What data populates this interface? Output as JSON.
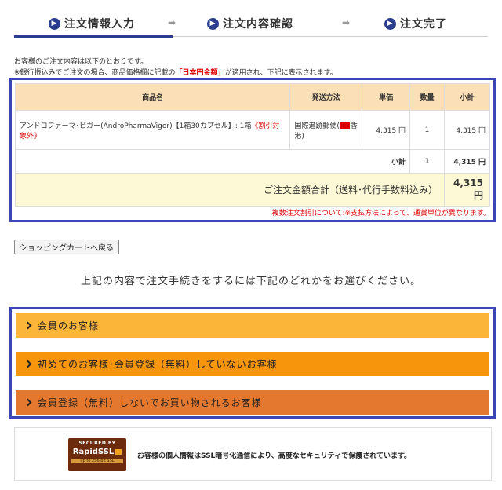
{
  "steps": [
    {
      "num": "1",
      "label": "注文情報入力"
    },
    {
      "num": "2",
      "label": "注文内容確認"
    },
    {
      "num": "3",
      "label": "注文完了"
    }
  ],
  "intro": {
    "line1": "お客様のご注文内容は以下のとおりです。",
    "line2_prefix": "※銀行振込みでご注文の場合、商品価格欄に記載の",
    "line2_highlight": "「日本円金額」",
    "line2_suffix": "が適用され、下記に表示されます。"
  },
  "order_table": {
    "headers": [
      "商品名",
      "発送方法",
      "単価",
      "数量",
      "小計"
    ],
    "row": {
      "name": "アンドロファーマ･ビガー(AndroPharmaVigor)【1箱30カプセル】: 1箱",
      "name_tag": "《割引対象外》",
      "shipping_prefix": "国際追跡郵便(",
      "shipping_suffix": "香港)",
      "price": "4,315 円",
      "qty": "1",
      "subtotal": "4,315 円"
    },
    "subtotal_row": {
      "label": "小計",
      "qty": "1",
      "value": "4,315 円"
    },
    "grand_total": {
      "label": "ご注文金額合計（送料･代行手数料込み）",
      "value": "4,315円"
    },
    "discount_note": "複数注文割引について:※支払方法によって、通貨単位が異なります。"
  },
  "back_button": "ショッピングカートへ戻る",
  "choose_text": "上記の内容で注文手続きをするには下記のどれかをお選びください。",
  "choices": [
    {
      "label": "会員のお客様"
    },
    {
      "label": "初めてのお客様･会員登録（無料）していないお客様"
    },
    {
      "label": "会員登録（無料）しないでお買い物されるお客様"
    }
  ],
  "ssl": {
    "badge_line1": "SECURED BY",
    "badge_line2": "RapidSSL",
    "badge_line3": "up to 256-bit SSL",
    "text": "お客様の個人情報はSSL暗号化通信により、高度なセキュリティで保護されています。"
  },
  "colors": {
    "accent": "#2a3d8f",
    "frame": "#3b46b8",
    "choice1": "#fbb539",
    "choice2": "#f7960c",
    "choice3": "#e5782f",
    "red": "#dd0000"
  }
}
